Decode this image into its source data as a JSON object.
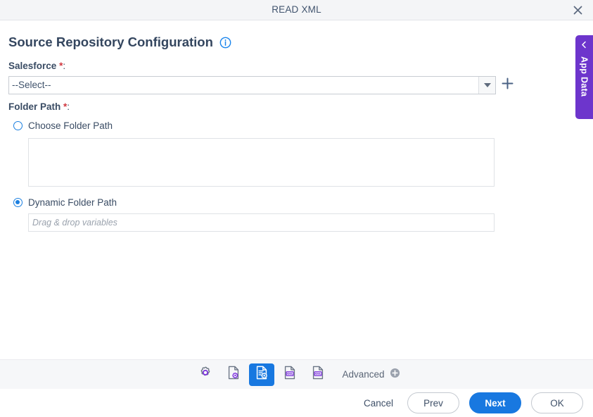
{
  "window": {
    "title": "READ XML",
    "close_icon": "close-icon"
  },
  "page": {
    "heading": "Source Repository Configuration",
    "info_icon": "info-icon"
  },
  "form": {
    "salesforce": {
      "label": "Salesforce",
      "required_mark": "*",
      "colon": ":",
      "selected_value": "--Select--",
      "dropdown_icon": "chevron-down-icon",
      "add_icon": "plus-icon"
    },
    "folder_path": {
      "label": "Folder Path",
      "required_mark": "*",
      "colon": ":",
      "choose": {
        "label": "Choose Folder Path",
        "selected": false,
        "value": ""
      },
      "dynamic": {
        "label": "Dynamic Folder Path",
        "selected": true,
        "value": "",
        "placeholder": "Drag & drop variables"
      }
    }
  },
  "app_data_tab": {
    "label": "App Data",
    "collapse_icon": "chevron-left-icon",
    "color": "#6d35cc"
  },
  "toolbar": {
    "items": [
      {
        "name": "settings-gear-icon",
        "label": "",
        "active": false
      },
      {
        "name": "document-settings-icon",
        "label": "",
        "active": false
      },
      {
        "name": "document-config-icon",
        "label": "",
        "active": true
      },
      {
        "name": "xml-document-icon",
        "label": "",
        "active": false
      },
      {
        "name": "xml-output-icon",
        "label": "",
        "active": false
      }
    ],
    "advanced_label": "Advanced",
    "advanced_icon": "circle-plus-icon"
  },
  "footer": {
    "cancel_label": "Cancel",
    "prev_label": "Prev",
    "next_label": "Next",
    "ok_label": "OK",
    "primary_color": "#1878e0"
  }
}
